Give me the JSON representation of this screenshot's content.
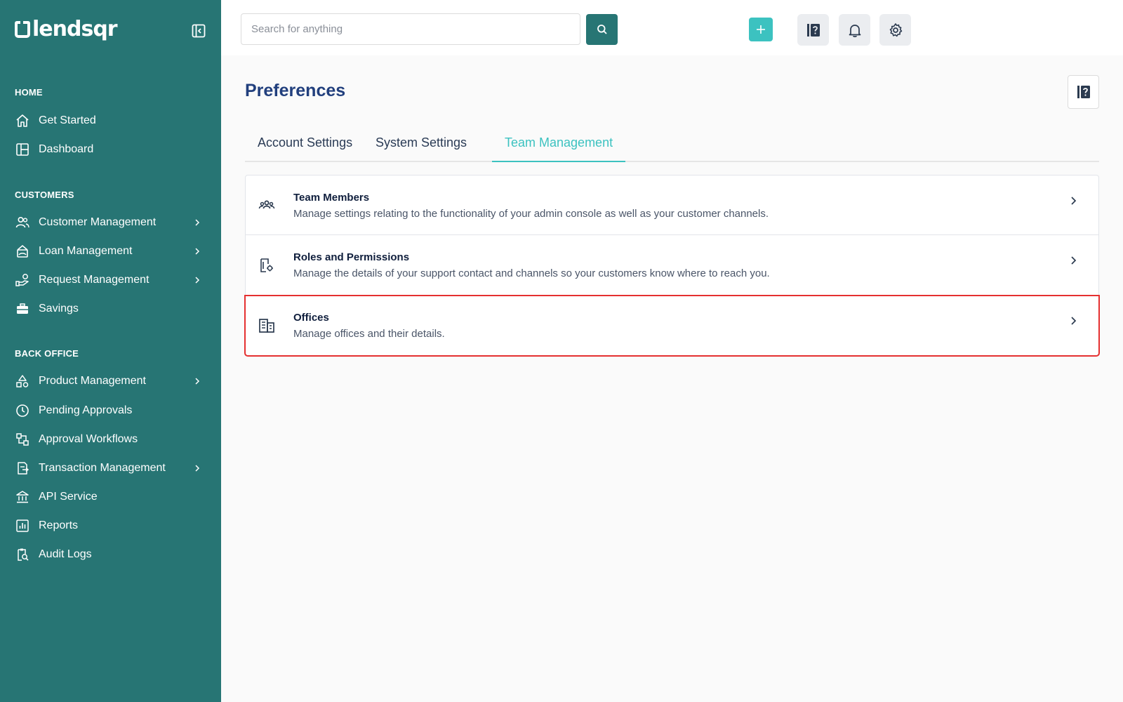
{
  "brand": {
    "name": "lendsqr"
  },
  "sidebar": {
    "sections": [
      {
        "title": "HOME"
      },
      {
        "title": "CUSTOMERS"
      },
      {
        "title": "BACK OFFICE"
      }
    ],
    "items": [
      {
        "label": "Get Started",
        "icon": "home-icon"
      },
      {
        "label": "Dashboard",
        "icon": "dashboard-icon"
      },
      {
        "label": "Customer Management",
        "icon": "users-icon",
        "expandable": true
      },
      {
        "label": "Loan Management",
        "icon": "loan-icon",
        "expandable": true
      },
      {
        "label": "Request Management",
        "icon": "request-icon",
        "expandable": true
      },
      {
        "label": "Savings",
        "icon": "briefcase-icon"
      },
      {
        "label": "Product Management",
        "icon": "shapes-icon",
        "expandable": true
      },
      {
        "label": "Pending Approvals",
        "icon": "clock-icon"
      },
      {
        "label": "Approval Workflows",
        "icon": "workflow-icon"
      },
      {
        "label": "Transaction Management",
        "icon": "transaction-icon",
        "expandable": true
      },
      {
        "label": "API Service",
        "icon": "bank-icon"
      },
      {
        "label": "Reports",
        "icon": "chart-icon"
      },
      {
        "label": "Audit Logs",
        "icon": "audit-icon"
      }
    ]
  },
  "topbar": {
    "search_placeholder": "Search for anything",
    "colors": {
      "primary": "#277574",
      "accent": "#3cc2c0"
    }
  },
  "page": {
    "title": "Preferences",
    "tabs": [
      {
        "label": "Account Settings",
        "active": false
      },
      {
        "label": "System Settings",
        "active": false
      },
      {
        "label": "Team Management",
        "active": true
      }
    ],
    "cards": [
      {
        "title": "Team Members",
        "description": "Manage settings relating to the functionality of your admin console as well as your customer channels.",
        "icon": "team-icon"
      },
      {
        "title": "Roles and Permissions",
        "description": "Manage the details of your support contact and channels so your customers know where to reach you.",
        "icon": "roles-icon"
      },
      {
        "title": "Offices",
        "description": "Manage offices and their details.",
        "icon": "building-icon",
        "highlighted": true
      }
    ]
  }
}
